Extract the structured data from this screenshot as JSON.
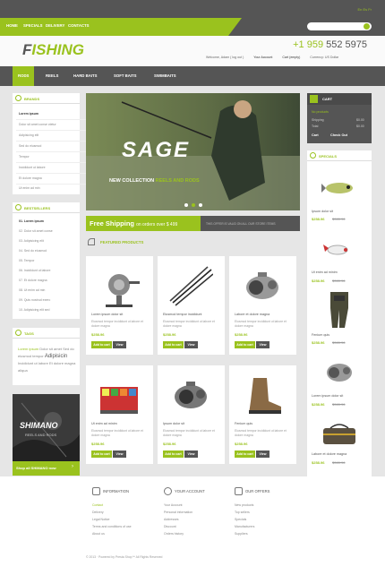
{
  "top": {
    "nav": [
      "HOME",
      "SPECIALS",
      "DELIVERY",
      "CONTACTS"
    ],
    "langs": "En  Es  Fr",
    "search_placeholder": ""
  },
  "header": {
    "logo_first": "F",
    "logo_rest": "ISHING",
    "phone_prefix": "+1 959",
    "phone_rest": " 552 5975",
    "welcome": "Welcome, Adam  ( log out )",
    "account": "Your Account",
    "cart": "Cart (empty)",
    "currency": "Currency: US Dollar"
  },
  "mainnav": [
    "RODS",
    "REELS",
    "HARD BAITS",
    "SOFT BAITS",
    "SWIMBAITS"
  ],
  "brands": {
    "title": "BRANDS",
    "items": [
      "Lorem ipsum",
      "Dolor sit amet conse ctetur",
      "Adipisicing elit",
      "Sed do eiusmod",
      "Tempor",
      "Incididunt ut labore",
      "Et dolore magna",
      "Ut enim ad min"
    ]
  },
  "bestsellers": {
    "title": "BESTSELLERS",
    "items": [
      "01. Lorem ipsum",
      "02. Dolor sit amet conse",
      "03. Adipisicing elit",
      "04. Sed do eiusmod",
      "05. Tempor",
      "06. Incididunt ut labore",
      "07. Et dolore magna",
      "08. Ut enim ad min",
      "09. Quis nostrud exerc",
      "10. Adipisicing elit sed"
    ]
  },
  "tags": {
    "title": "TAGS",
    "text1": "Lorem ipsum",
    "text2": "Dolor sit amet",
    "text3": "Sed do eiusmod tempor",
    "text4": "Adipisicin",
    "text5": "Incididunt ut labore",
    "text6": "Et dolore magna aliqua"
  },
  "shimano": {
    "brand": "SHIMANO",
    "sub": "REELS AND RODS",
    "cta": "Shop all SHIMANO now"
  },
  "banner": {
    "brand": "SAGE",
    "line_first": "NEW COLLECTION",
    "line_green": "REELS AND RODS"
  },
  "shipping": {
    "lead": "Free Shipping",
    "rest": "on orders over $ 499",
    "note": "THIS OFFER IS VALID ON ALL OUR STORE ITEMS"
  },
  "featured": {
    "title": "FEATURED PRODUCTS",
    "add_label": "Add to cart",
    "view_label": "View",
    "products": [
      {
        "name": "Lorem ipsum dolor sit",
        "desc": "Eiusmod tempor incididunt ut labore et dolore magna",
        "price": "$258.96",
        "icon": "reel-icon"
      },
      {
        "name": "Eiusmod tempor incididunt",
        "desc": "Eiusmod tempor incididunt ut labore et dolore magna",
        "price": "$258.96",
        "icon": "rods-icon"
      },
      {
        "name": "Labore et dolore magna",
        "desc": "Eiusmod tempor incididunt ut labore et dolore magna",
        "price": "$258.96",
        "icon": "baitcast-reel-icon"
      },
      {
        "name": "Ut enim ad minim",
        "desc": "Eiusmod tempor incididunt ut labore et dolore magna",
        "price": "$258.96",
        "icon": "tackle-box-icon"
      },
      {
        "name": "Ipsum dolor sit",
        "desc": "Eiusmod tempor incididunt ut labore et dolore magna",
        "price": "$258.96",
        "icon": "baitcast-reel-icon"
      },
      {
        "name": "Fenium quis",
        "desc": "Eiusmod tempor incididunt ut labore et dolore magna",
        "price": "$258.96",
        "icon": "boot-icon"
      }
    ]
  },
  "cart": {
    "title": "CART",
    "empty": "No products",
    "shipping_label": "Shipping",
    "shipping_val": "$0.00",
    "total_label": "Total",
    "total_val": "$0.00",
    "cart_btn": "Cart",
    "checkout_btn": "Check Out"
  },
  "specials": {
    "title": "SPECIALS",
    "items": [
      {
        "name": "Ipsum dolor sit",
        "price": "$258.96",
        "old": "$365.96",
        "icon": "lure-icon"
      },
      {
        "name": "Ut enim ad minim",
        "price": "$258.96",
        "old": "$365.96",
        "icon": "lure-icon"
      },
      {
        "name": "Fenium quis",
        "price": "$258.96",
        "old": "$365.96",
        "icon": "waders-icon"
      },
      {
        "name": "Lorem ipsum dolor sit",
        "price": "$258.96",
        "old": "$365.96",
        "icon": "reel-icon"
      },
      {
        "name": "Labore et dolore magna",
        "price": "$258.96",
        "old": "$365.96",
        "icon": "bag-icon"
      }
    ]
  },
  "footer": {
    "info": {
      "title": "INFORMATION",
      "links": [
        "Contact",
        "Delivery",
        "Legal Notice",
        "Terms and conditions of use",
        "About us"
      ]
    },
    "account": {
      "title": "YOUR ACCOUNT",
      "links": [
        "Your Account",
        "Personal information",
        "Addresses",
        "Discount",
        "Orders history"
      ]
    },
    "offers": {
      "title": "OUR OFFERS",
      "links": [
        "New products",
        "Top sellers",
        "Specials",
        "Manufacturers",
        "Suppliers"
      ]
    },
    "copyright": "© 2013 · Powered by Presta Shop™ All Rights Reserved"
  },
  "colors": {
    "accent": "#9ac21e",
    "dark": "#555555"
  }
}
